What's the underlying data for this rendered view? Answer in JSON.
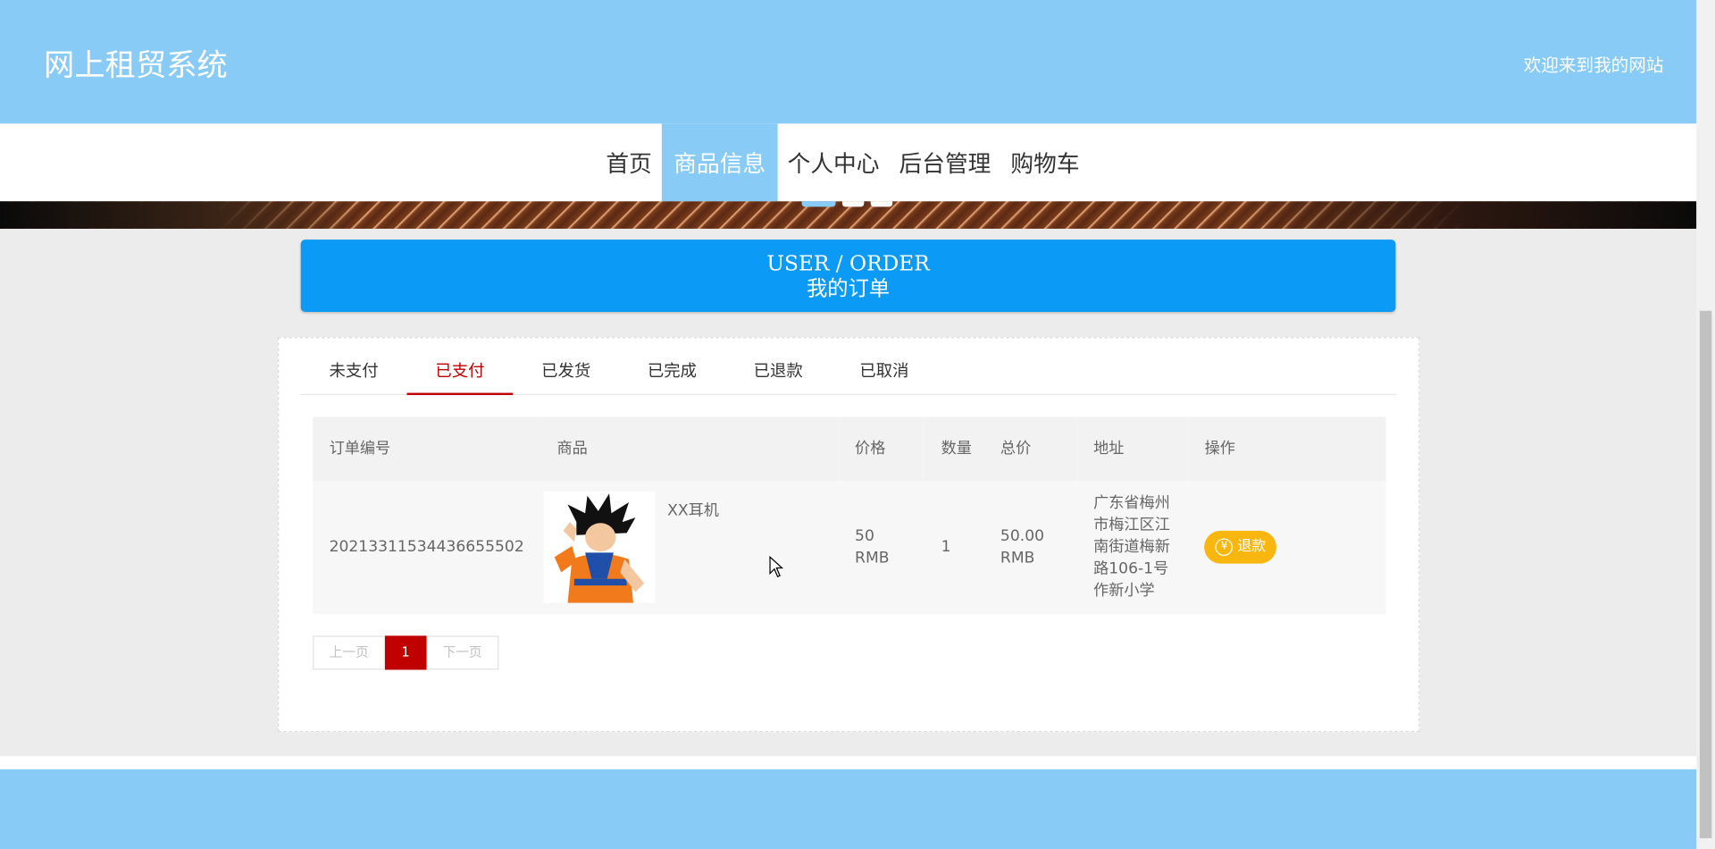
{
  "header": {
    "site_title": "网上租贸系统",
    "welcome": "欢迎来到我的网站"
  },
  "nav": {
    "items": [
      "首页",
      "商品信息",
      "个人中心",
      "后台管理",
      "购物车"
    ],
    "active": "商品信息"
  },
  "order_title": {
    "en": "USER / ORDER",
    "cn": "我的订单"
  },
  "tabs": {
    "items": [
      "未支付",
      "已支付",
      "已发货",
      "已完成",
      "已退款",
      "已取消"
    ],
    "active": "已支付"
  },
  "table": {
    "headers": [
      "订单编号",
      "商品",
      "价格",
      "数量",
      "总价",
      "地址",
      "操作"
    ],
    "rows": [
      {
        "order_no": "2021331153443665550",
        "order_no_suffix": "2",
        "goods_name": "XX耳机",
        "goods_image_icon": "product-thumbnail-icon",
        "price": "50 RMB",
        "quantity": "1",
        "total": "50.00 RMB",
        "address": "广东省梅州市梅江区江南街道梅新路106-1号作新小学",
        "action": "退款"
      }
    ]
  },
  "pager": {
    "prev": "上一页",
    "current": "1",
    "next": "下一页"
  },
  "colors": {
    "header_bg": "#87cbf6",
    "title_box": "#0b9bf6",
    "active_tab": "#c00000",
    "refund_button": "#f9b60f"
  }
}
